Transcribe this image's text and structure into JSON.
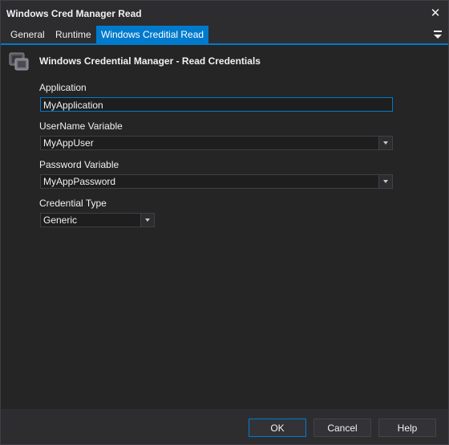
{
  "window": {
    "title": "Windows Cred Manager Read",
    "close_glyph": "✕"
  },
  "tabs": [
    {
      "label": "General"
    },
    {
      "label": "Runtime"
    },
    {
      "label": "Windows Creditial Read"
    }
  ],
  "tab_menu_icon": "tab-overflow-menu-icon",
  "header": {
    "title": "Windows Credential Manager - Read Credentials",
    "icon": "credential-manager-icon"
  },
  "form": {
    "application": {
      "label": "Application",
      "value": "MyApplication"
    },
    "username_variable": {
      "label": "UserName Variable",
      "value": "MyAppUser"
    },
    "password_variable": {
      "label": "Password Variable",
      "value": "MyAppPassword"
    },
    "credential_type": {
      "label": "Credential Type",
      "value": "Generic"
    }
  },
  "buttons": {
    "ok": "OK",
    "cancel": "Cancel",
    "help": "Help"
  },
  "colors": {
    "accent": "#007acc",
    "background": "#2d2d30",
    "panel": "#252526",
    "field": "#1e1e1e"
  }
}
